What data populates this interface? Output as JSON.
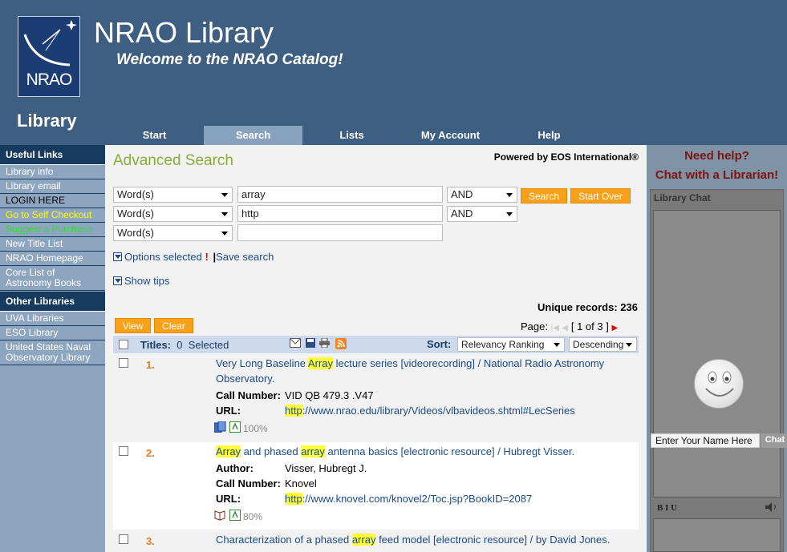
{
  "header": {
    "logo_text": "NRAO",
    "library_word": "Library",
    "title": "NRAO Library",
    "subtitle": "Welcome to the NRAO Catalog!",
    "nav": [
      {
        "label": "Start"
      },
      {
        "label": "Search"
      },
      {
        "label": "Lists"
      },
      {
        "label": "My Account"
      },
      {
        "label": "Help"
      }
    ]
  },
  "sidebar": {
    "useful_heading": "Useful Links",
    "useful_links": [
      "Library info",
      "Library email",
      "LOGIN HERE",
      "Go to Self Checkout",
      "Suggest a Purchase",
      "New Title List",
      "NRAO Homepage",
      "Core List of Astronomy Books"
    ],
    "other_heading": "Other Libraries",
    "other_links": [
      "UVA Libraries",
      "ESO Library",
      "United States Naval Observatory Library"
    ]
  },
  "search": {
    "heading": "Advanced Search",
    "powered_by": "Powered by EOS International®",
    "rows": [
      {
        "field": "Word(s)",
        "value": "array",
        "op": "AND"
      },
      {
        "field": "Word(s)",
        "value": "http",
        "op": "AND"
      },
      {
        "field": "Word(s)",
        "value": ""
      }
    ],
    "search_btn": "Search",
    "startover_btn": "Start Over",
    "options_selected": "Options selected",
    "options_mark": "!",
    "save_search": "Save search",
    "show_tips": "Show tips"
  },
  "results": {
    "unique_records_label": "Unique records:",
    "unique_records": "236",
    "view_btn": "View",
    "clear_btn": "Clear",
    "page_label": "Page:",
    "page_info": "[ 1 of 3 ]",
    "titles_label": "Titles:",
    "selected_count": "0",
    "selected_label": "Selected",
    "sort_label": "Sort:",
    "sort_value": "Relevancy Ranking",
    "order_value": "Descending",
    "items": [
      {
        "num": "1.",
        "title_parts": [
          "Very Long Baseline ",
          "Array",
          " lecture series [videorecording] / National Radio Astronomy Observatory."
        ],
        "call_label": "Call Number:",
        "call_value": "VID QB 479.3 .V47",
        "url_label": "URL:",
        "url_hl": "http",
        "url_rest": "://www.nrao.edu/library/Videos/vlbavideos.shtml#LecSeries",
        "relevance": "100%"
      },
      {
        "num": "2.",
        "title_a": "Array",
        "title_b": " and phased ",
        "title_c": "array",
        "title_d": " antenna basics [electronic resource] / Hubregt Visser.",
        "author_label": "Author:",
        "author_value": "Visser, Hubregt J.",
        "call_label": "Call Number:",
        "call_value": "Knovel",
        "url_label": "URL:",
        "url_hl": "http",
        "url_rest": "://www.knovel.com/knovel2/Toc.jsp?BookID=2087",
        "relevance": "80%"
      },
      {
        "num": "3.",
        "title_parts": [
          "Characterization of a phased ",
          "array",
          " feed model [electronic resource] / by David Jones."
        ]
      }
    ]
  },
  "chat": {
    "need_help": "Need help?",
    "chat_with": "Chat with a Librarian!",
    "widget_title": "Library Chat",
    "name_placeholder": "Enter Your Name Here",
    "chat_btn": "Chat",
    "format_bar": "B  I  U"
  }
}
